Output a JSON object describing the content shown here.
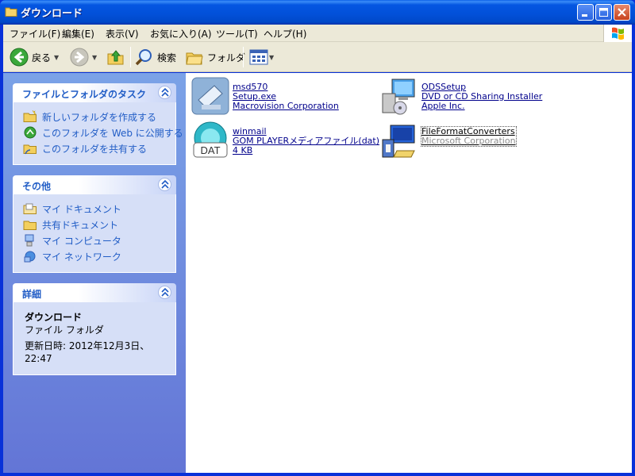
{
  "window": {
    "title": "ダウンロード"
  },
  "menu": [
    "ファイル(F)",
    "編集(E)",
    "表示(V)",
    "お気に入り(A)",
    "ツール(T)",
    "ヘルプ(H)"
  ],
  "toolbar": {
    "back": "戻る",
    "search": "検索",
    "folders": "フォルダ"
  },
  "tasks_panel": {
    "title": "ファイルとフォルダのタスク",
    "items": [
      "新しいフォルダを作成する",
      "このフォルダを Web に公開する",
      "このフォルダを共有する"
    ]
  },
  "other_panel": {
    "title": "その他",
    "items": [
      "マイ ドキュメント",
      "共有ドキュメント",
      "マイ コンピュータ",
      "マイ ネットワーク"
    ]
  },
  "details_panel": {
    "title": "詳細",
    "name": "ダウンロード",
    "type": "ファイル フォルダ",
    "modified": "更新日時: 2012年12月3日、22:47"
  },
  "files": [
    {
      "name": "msd570",
      "line2": "Setup.exe",
      "line3": "Macrovision Corporation",
      "icon": "installer-icon"
    },
    {
      "name": "ODSSetup",
      "line2": "DVD or CD Sharing Installer",
      "line3": "Apple Inc.",
      "icon": "setup-computer-icon"
    },
    {
      "name": "winmail",
      "line2": "GOM PLAYERメディアファイル(dat)",
      "line3": "4 KB",
      "icon": "dat-file-icon"
    },
    {
      "name": "FileFormatConverters",
      "line2": "Microsoft Corporation",
      "line3": "",
      "icon": "msi-installer-icon"
    }
  ]
}
